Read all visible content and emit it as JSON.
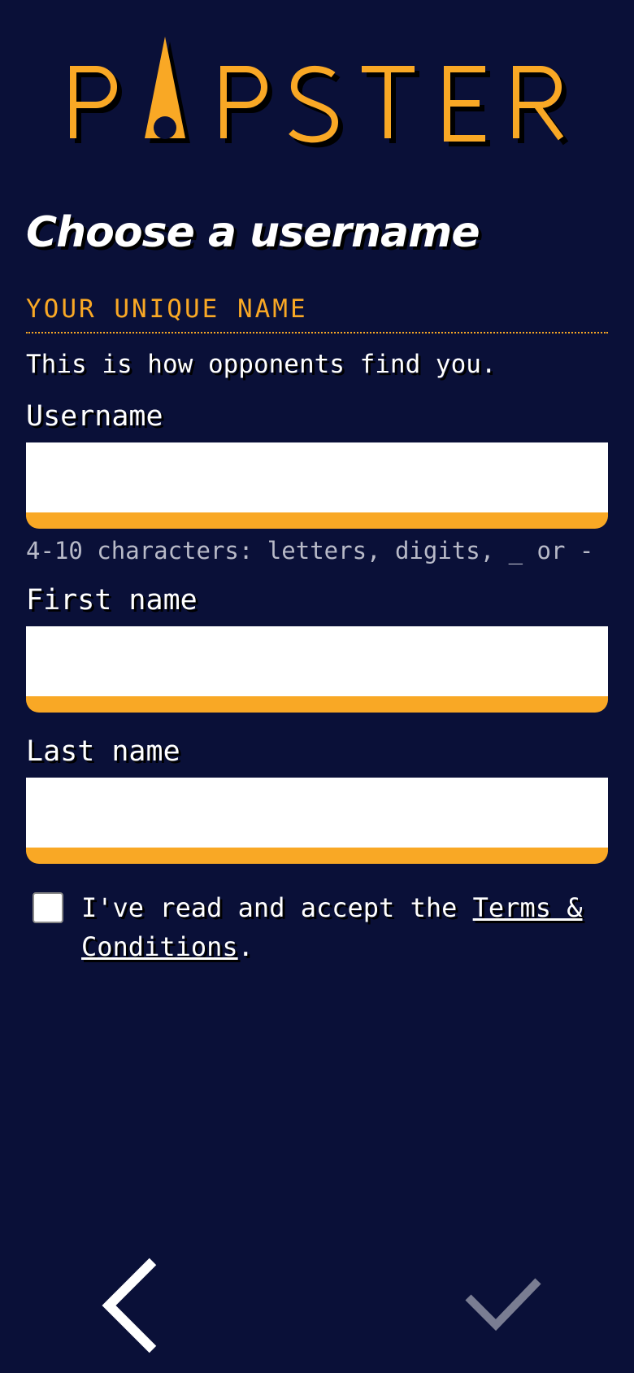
{
  "app": {
    "logo_text": "PAPSTER"
  },
  "page": {
    "title": "Choose a username",
    "section_heading": "YOUR UNIQUE NAME",
    "description": "This is how opponents find you."
  },
  "form": {
    "username": {
      "label": "Username",
      "value": "",
      "hint": "4-10 characters: letters, digits, _ or -"
    },
    "first_name": {
      "label": "First name",
      "value": ""
    },
    "last_name": {
      "label": "Last name",
      "value": ""
    },
    "terms": {
      "checked": false,
      "text_before": "I've read and accept the ",
      "link_text": "Terms & Conditions",
      "text_after": "."
    }
  },
  "nav": {
    "back_icon": "chevron-left-icon",
    "confirm_icon": "check-icon"
  },
  "colors": {
    "background": "#0a1038",
    "accent": "#f9a825",
    "text": "#ffffff",
    "hint": "#b8bac8",
    "confirm_disabled": "#7a7d92"
  }
}
